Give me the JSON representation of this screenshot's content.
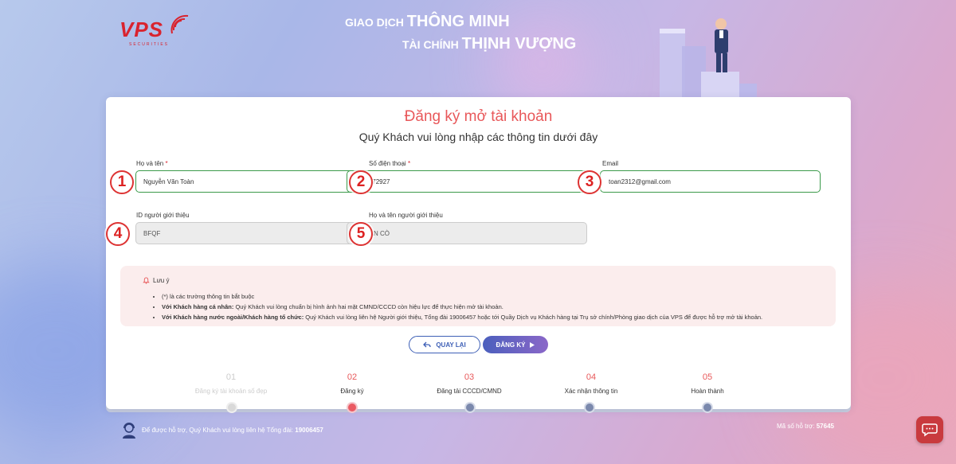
{
  "header": {
    "logo_text": "VPS",
    "logo_sub": "SECURITIES",
    "slogan1_prefix": "GIAO DỊCH",
    "slogan1_main": "THÔNG MINH",
    "slogan2_prefix": "TÀI CHÍNH",
    "slogan2_main": "THỊNH VƯỢNG"
  },
  "form": {
    "title": "Đăng ký mở tài khoản",
    "subtitle": "Quý Khách vui lòng nhập các thông tin dưới đây",
    "fields": [
      {
        "label": "Họ và tên",
        "required": "*",
        "value": "Nguyễn Văn Toàn",
        "marker": "1"
      },
      {
        "label": "Số điện thoại",
        "required": "*",
        "value": "0966972927",
        "marker": "2"
      },
      {
        "label": "Email",
        "required": "",
        "value": "toan2312@gmail.com",
        "marker": "3"
      },
      {
        "label": "ID người giới thiệu",
        "required": "",
        "value": "BFQF",
        "marker": "4"
      },
      {
        "label": "Họ và tên người giới thiệu",
        "required": "",
        "value": "VŨ VĂN CÒ",
        "marker": "5"
      }
    ]
  },
  "note": {
    "title": "Lưu ý",
    "items": [
      {
        "bold": "",
        "text": "(*) là các trường thông tin bắt buộc"
      },
      {
        "bold": "Với Khách hàng cá nhân:",
        "text": " Quý Khách vui lòng chuẩn bị hình ảnh hai mặt CMND/CCCD còn hiệu lực để thực hiện mở tài khoản."
      },
      {
        "bold": "Với Khách hàng nước ngoài/Khách hàng tổ chức:",
        "text": " Quý Khách vui lòng liên hệ Người giới thiệu, Tổng đài 19006457 hoặc tới Quầy Dịch vụ Khách hàng tại Trụ sở chính/Phòng giao dịch của VPS để được hỗ trợ mở tài khoản."
      }
    ]
  },
  "buttons": {
    "back": "QUAY LẠI",
    "register": "ĐĂNG KÝ"
  },
  "steps": [
    {
      "num": "01",
      "label": "Đăng ký tài khoản số đẹp",
      "state": "done"
    },
    {
      "num": "02",
      "label": "Đăng ký",
      "state": "active"
    },
    {
      "num": "03",
      "label": "Đăng tải CCCD/CMND",
      "state": "pending"
    },
    {
      "num": "04",
      "label": "Xác nhận thông tin",
      "state": "pending"
    },
    {
      "num": "05",
      "label": "Hoàn thành",
      "state": "pending"
    }
  ],
  "footer": {
    "support_prefix": "Để được hỗ trợ, Quý Khách vui lòng liên hệ Tổng đài:",
    "support_phone": "19006457",
    "code_prefix": "Mã số hỗ trợ:",
    "code": "57645"
  }
}
